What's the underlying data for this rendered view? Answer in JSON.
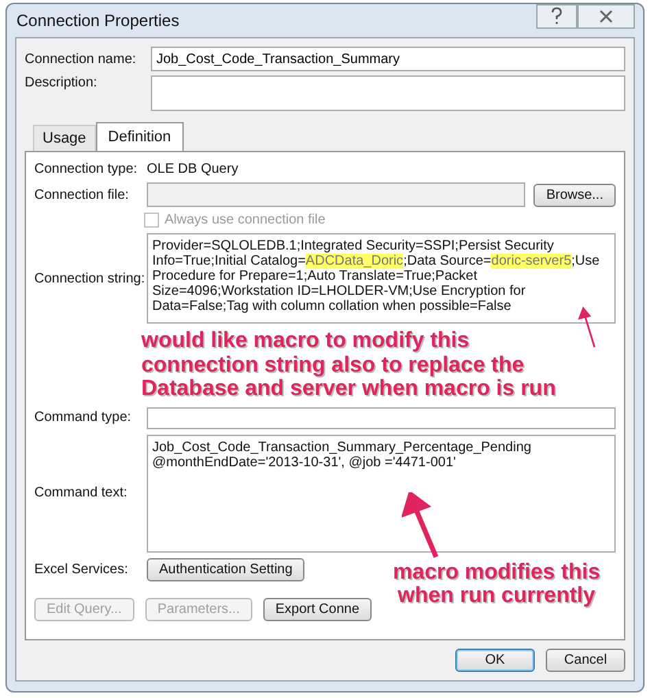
{
  "window": {
    "title": "Connection Properties"
  },
  "connection_name": {
    "label": "Connection name:",
    "value": "Job_Cost_Code_Transaction_Summary"
  },
  "description": {
    "label": "Description:"
  },
  "tabs": [
    {
      "label": "Usage",
      "selected": false
    },
    {
      "label": "Definition",
      "selected": true
    }
  ],
  "connection_type": {
    "label": "Connection type:",
    "value": "OLE DB Query"
  },
  "connection_file": {
    "label": "Connection file:",
    "disabled": true,
    "button": "Browse..."
  },
  "always_use_file": {
    "label": "Always use connection file",
    "checked": false,
    "disabled": true
  },
  "connection_string": {
    "label": "Connection string:",
    "segments": [
      {
        "text": "Provider=SQLOLEDB.1;Integrated Security=SSPI;Persist Security Info=True;Initial Catalog=",
        "highlighted": false
      },
      {
        "text": "ADCData_Doric",
        "highlighted": true
      },
      {
        "text": ";Data Source=",
        "highlighted": false
      },
      {
        "text": "doric-server5",
        "highlighted": true
      },
      {
        "text": ";Use Procedure for Prepare=1;Auto Translate=True;Packet Size=4096;Workstation ID=LHOLDER-VM;Use Encryption for Data=False;Tag with column collation when possible=False",
        "highlighted": false
      }
    ]
  },
  "command_type": {
    "label": "Command type:"
  },
  "command_text": {
    "label": "Command text:",
    "lines": [
      "Job_Cost_Code_Transaction_Summary_Percentage_Pending",
      "@monthEndDate='2013-10-31', @job ='4471-001'"
    ]
  },
  "excel_services": {
    "label": "Excel Services:",
    "button": "Authentication Setting"
  },
  "action_buttons": [
    {
      "label": "Edit Query...",
      "disabled": true
    },
    {
      "label": "Parameters...",
      "disabled": true
    },
    {
      "label": "Export Conne",
      "disabled": false
    }
  ],
  "footer_buttons": [
    {
      "label": "OK",
      "default": true
    },
    {
      "label": "Cancel",
      "default": false
    }
  ],
  "annotations": [
    {
      "text": "would like macro to modify this connection string also to replace the Database and server when macro is run"
    },
    {
      "text": "macro modifies this when run currently"
    }
  ]
}
